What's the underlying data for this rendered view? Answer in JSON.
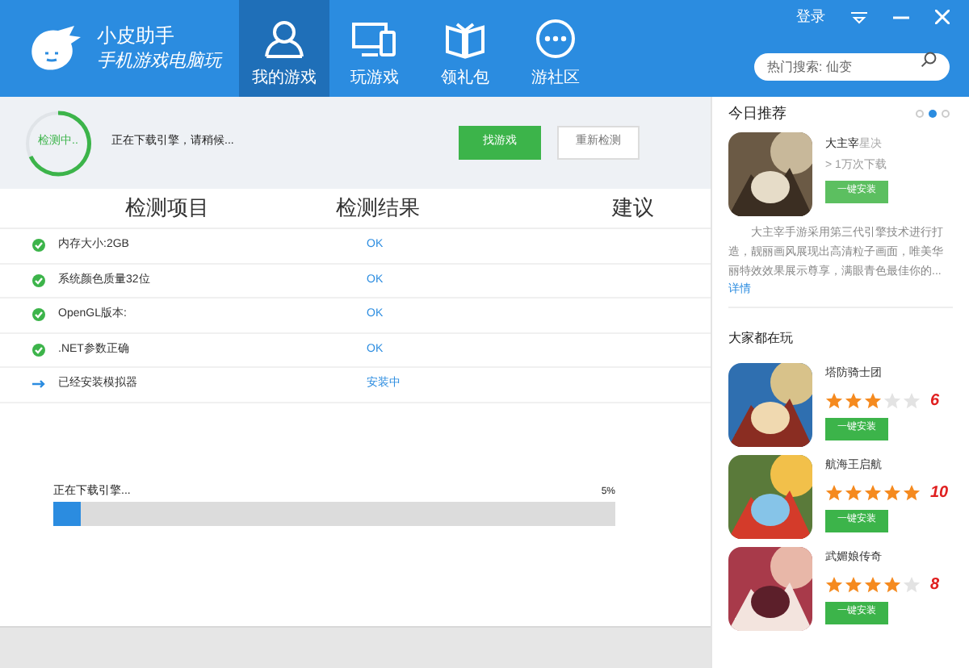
{
  "header": {
    "app_name": "小皮助手",
    "slogan": "手机游戏电脑玩",
    "login": "登录",
    "search": {
      "placeholder": "热门搜索: 仙变"
    },
    "nav": [
      {
        "label": "我的游戏",
        "kind": "user",
        "selected": true
      },
      {
        "label": "玩游戏",
        "kind": "devices",
        "selected": false
      },
      {
        "label": "领礼包",
        "kind": "book",
        "selected": false
      },
      {
        "label": "游社区",
        "kind": "chat",
        "selected": false
      }
    ]
  },
  "status": {
    "spinner_label": "检测中..",
    "message": "正在下载引擎，请稍候...",
    "buttons": [
      {
        "label": "找游戏",
        "kind": "primary"
      },
      {
        "label": "重新检测",
        "kind": "secondary"
      }
    ]
  },
  "table": {
    "columns": [
      "检测项目",
      "检测结果",
      "建议"
    ],
    "rows": [
      {
        "item": "内存大小:2GB",
        "result": "OK",
        "kind": "ok"
      },
      {
        "item": "系统颜色质量32位",
        "result": "OK",
        "kind": "ok"
      },
      {
        "item": "OpenGL版本:",
        "result": "OK",
        "kind": "ok"
      },
      {
        "item": ".NET参数正确",
        "result": "OK",
        "kind": "ok"
      },
      {
        "item": "已经安装模拟器",
        "result": "安装中",
        "kind": "pending"
      }
    ]
  },
  "progress": {
    "label": "正在下载引擎...",
    "reading": "5%",
    "level": 0.05
  },
  "sidebar": {
    "today": {
      "title": "今日推荐",
      "dots": [
        {
          "selected": false
        },
        {
          "selected": true
        },
        {
          "selected": false
        }
      ],
      "game": {
        "name": "大主宰",
        "name_suffix": "星决",
        "downloads": "> 1万次下载",
        "button": "一键安装",
        "description": "大主宰手游采用第三代引擎技术进行打造，靓丽画风展现出高清粒子画面，唯美华丽特效效果展示尊享，满眼青色最佳你的...",
        "link": "详情"
      }
    },
    "popular": {
      "title": "大家都在玩",
      "games": [
        {
          "name": "塔防骑士团",
          "stars": 3,
          "score": "6",
          "button": "一键安装"
        },
        {
          "name": "航海王启航",
          "stars": 5,
          "score": "10",
          "button": "一键安装"
        },
        {
          "name": "武媚娘传奇",
          "stars": 4,
          "score": "8",
          "button": "一键安装"
        }
      ]
    }
  }
}
